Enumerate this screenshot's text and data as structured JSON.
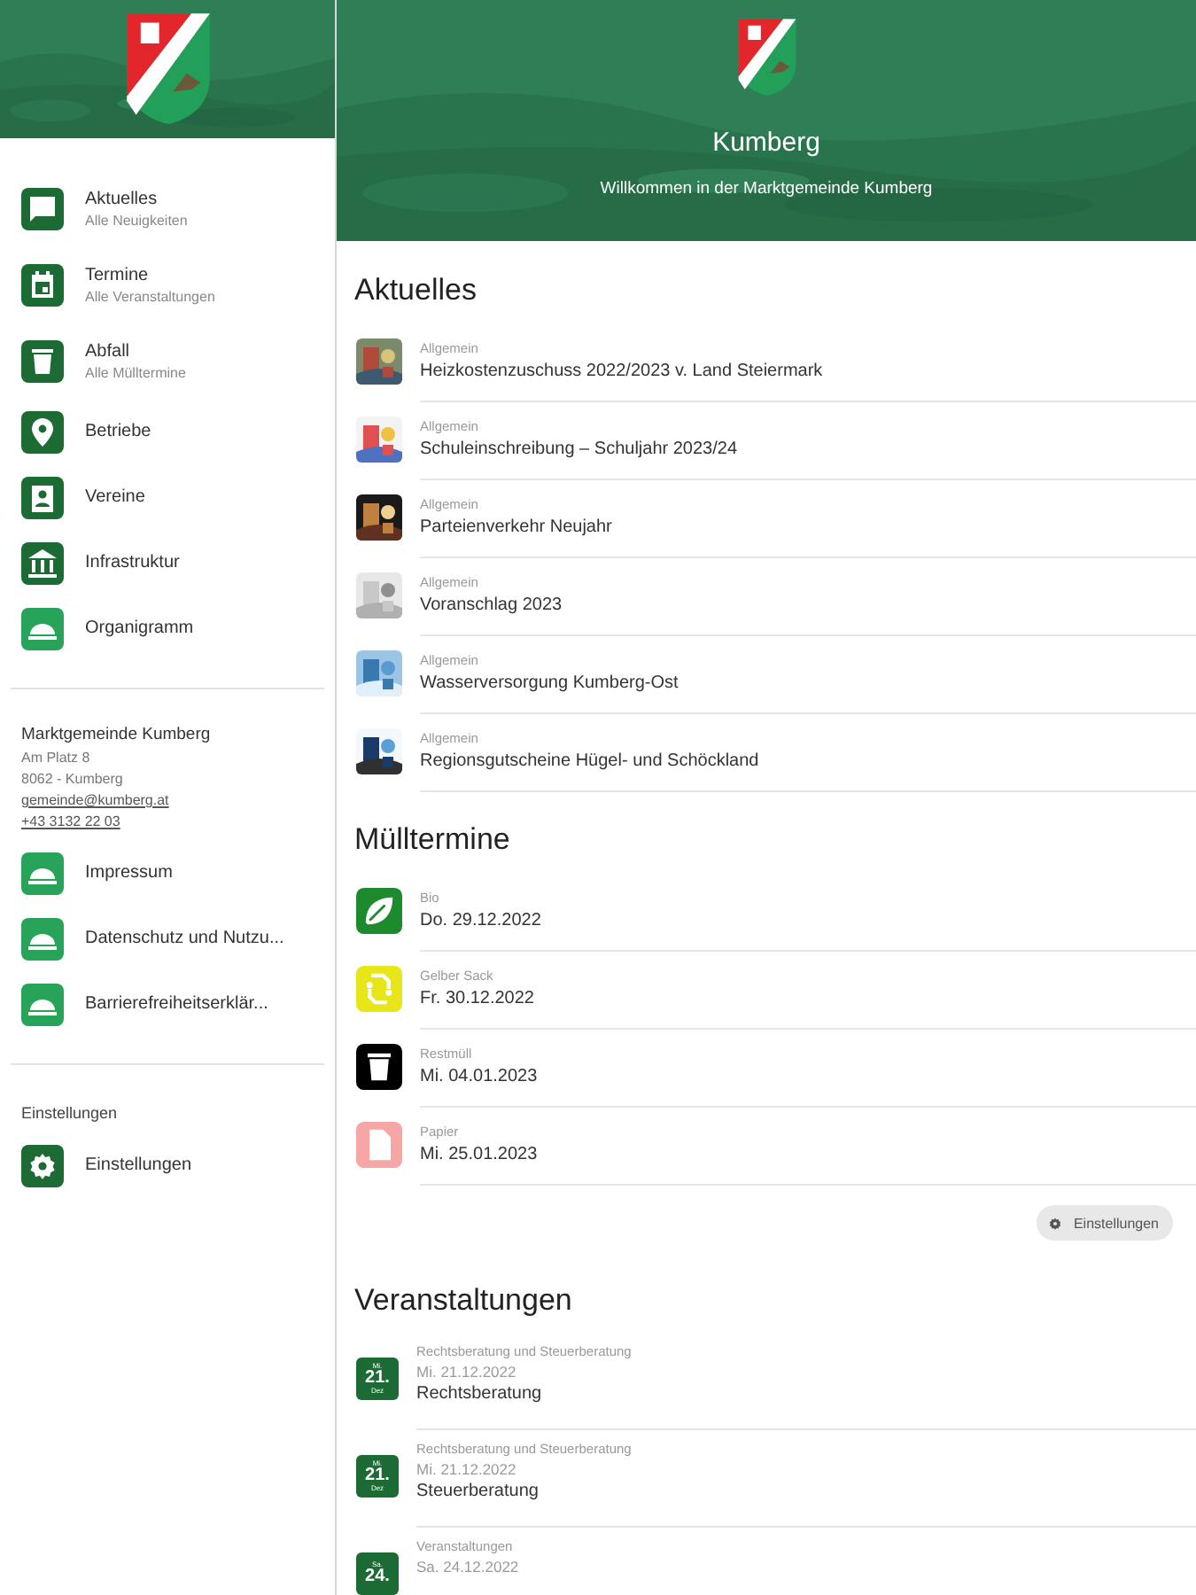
{
  "sidebar": {
    "nav": [
      {
        "kind": "chat",
        "label": "Aktuelles",
        "sublabel": "Alle Neuigkeiten"
      },
      {
        "kind": "calendar",
        "label": "Termine",
        "sublabel": "Alle Veranstaltungen"
      },
      {
        "kind": "trash",
        "label": "Abfall",
        "sublabel": "Alle Mülltermine"
      },
      {
        "kind": "pin",
        "label": "Betriebe"
      },
      {
        "kind": "badge",
        "label": "Vereine"
      },
      {
        "kind": "bank",
        "label": "Infrastruktur"
      },
      {
        "kind": "dome",
        "label": "Organigramm"
      }
    ],
    "contact": {
      "name": "Marktgemeinde Kumberg",
      "address": [
        "Am Platz 8",
        "8062 - Kumberg"
      ],
      "email": "gemeinde@kumberg.at",
      "phone": "+43 3132 22 03"
    },
    "links": [
      {
        "kind": "dome",
        "label": "Impressum"
      },
      {
        "kind": "dome",
        "label": "Datenschutz und Nutzu..."
      },
      {
        "kind": "dome",
        "label": "Barrierefreiheitserklär..."
      }
    ],
    "settings_heading": "Einstellungen",
    "settings_items": [
      {
        "kind": "gear",
        "label": "Einstellungen"
      }
    ]
  },
  "header": {
    "title": "Kumberg",
    "subtitle": "Willkommen in der Marktgemeinde Kumberg"
  },
  "news": {
    "title": "Aktuelles",
    "items": [
      {
        "category": "Allgemein",
        "title": "Heizkostenzuschuss 2022/2023 v. Land Steiermark"
      },
      {
        "category": "Allgemein",
        "title": "Schuleinschreibung – Schuljahr 2023/24"
      },
      {
        "category": "Allgemein",
        "title": "Parteienverkehr Neujahr"
      },
      {
        "category": "Allgemein",
        "title": "Voranschlag 2023"
      },
      {
        "category": "Allgemein",
        "title": "Wasserversorgung Kumberg-Ost"
      },
      {
        "category": "Allgemein",
        "title": "Regionsgutscheine Hügel- und Schöckland"
      }
    ]
  },
  "waste": {
    "title": "Mülltermine",
    "items": [
      {
        "kind": "leaf",
        "color": "#1e8a2e",
        "type": "Bio",
        "date": "Do. 29.12.2022"
      },
      {
        "kind": "recycle",
        "color": "#e6e619",
        "type": "Gelber Sack",
        "date": "Fr. 30.12.2022"
      },
      {
        "kind": "trash",
        "color": "#000000",
        "type": "Restmüll",
        "date": "Mi. 04.01.2023"
      },
      {
        "kind": "paper",
        "color": "#f7a6a6",
        "type": "Papier",
        "date": "Mi. 25.01.2023"
      }
    ],
    "settings_button": "Einstellungen"
  },
  "events": {
    "title": "Veranstaltungen",
    "items": [
      {
        "weekday": "Mi.",
        "day": "21.",
        "month": "Dez",
        "category": "Rechtsberatung und Steuerberatung",
        "date": "Mi. 21.12.2022",
        "title": "Rechtsberatung"
      },
      {
        "weekday": "Mi.",
        "day": "21.",
        "month": "Dez",
        "category": "Rechtsberatung und Steuerberatung",
        "date": "Mi. 21.12.2022",
        "title": "Steuerberatung"
      },
      {
        "weekday": "Sa.",
        "day": "24.",
        "category": "Veranstaltungen",
        "date": "Sa. 24.12.2022"
      }
    ]
  }
}
